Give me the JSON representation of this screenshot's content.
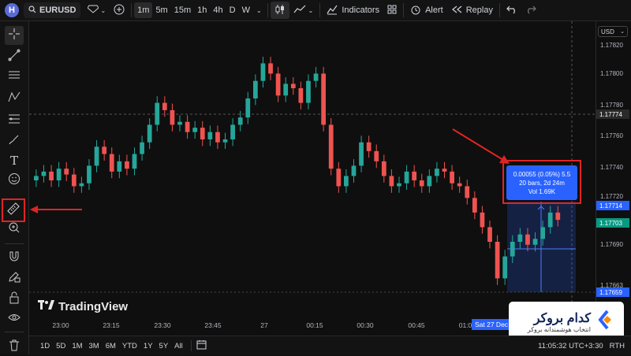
{
  "topbar": {
    "logo_letter": "H",
    "symbol": "EURUSD",
    "intervals": [
      "1m",
      "5m",
      "15m",
      "1h",
      "4h",
      "D",
      "W"
    ],
    "active_interval": "1m",
    "indicators_label": "Indicators",
    "alert_label": "Alert",
    "replay_label": "Replay"
  },
  "price_axis": {
    "currency": "USD",
    "labels": [
      "1.17820",
      "1.17800",
      "1.17780",
      "1.17760",
      "1.17740",
      "1.17720",
      "1.17690",
      "1.17663"
    ],
    "tags": [
      {
        "text": "1.17774",
        "bg": "#2a2a2a",
        "color": "#ffffff"
      },
      {
        "text": "1.17714",
        "bg": "#2962ff",
        "color": "#ffffff"
      },
      {
        "text": "1.17703",
        "bg": "#089981",
        "color": "#ffffff"
      },
      {
        "text": "1.17659",
        "bg": "#2962ff",
        "color": "#ffffff"
      }
    ]
  },
  "time_axis": {
    "labels": [
      "23:00",
      "23:15",
      "23:30",
      "23:45",
      "27",
      "00:15",
      "00:30",
      "00:45",
      "01:0"
    ],
    "highlight": "Sat 27 Dec"
  },
  "measure": {
    "line1": "0.00055 (0.05%) 5.5",
    "line2": "20 bars, 2d 24m",
    "line3": "Vol 1.69K"
  },
  "watermark": "TradingView",
  "bottom": {
    "ranges": [
      "1D",
      "5D",
      "1M",
      "3M",
      "6M",
      "YTD",
      "1Y",
      "5Y",
      "All"
    ],
    "clock": "11:05:32 UTC+3:30",
    "session": "RTH"
  },
  "brand": {
    "title": "کدام بروکر",
    "subtitle": "انتخاب هوشمندانه بروکر"
  },
  "colors": {
    "up": "#26a69a",
    "down": "#ef5350",
    "accent": "#2962ff",
    "annotation": "#e02424"
  },
  "chart_data": {
    "type": "candlestick",
    "symbol": "EURUSD",
    "interval": "1m",
    "y_range": [
      1.17655,
      1.1783
    ],
    "closes": [
      1.17735,
      1.17738,
      1.17732,
      1.1774,
      1.17736,
      1.17728,
      1.1773,
      1.17742,
      1.17755,
      1.1775,
      1.17738,
      1.17745,
      1.1774,
      1.1775,
      1.17758,
      1.1777,
      1.17785,
      1.1778,
      1.1777,
      1.17772,
      1.17765,
      1.17768,
      1.1776,
      1.17765,
      1.17758,
      1.1776,
      1.1777,
      1.17775,
      1.17788,
      1.178,
      1.17812,
      1.17805,
      1.1779,
      1.17798,
      1.17795,
      1.17785,
      1.178,
      1.17805,
      1.1777,
      1.1774,
      1.17728,
      1.17735,
      1.17742,
      1.17758,
      1.17752,
      1.17745,
      1.17735,
      1.17728,
      1.1773,
      1.17738,
      1.17732,
      1.17728,
      1.17735,
      1.1774,
      1.17738,
      1.1773,
      1.17728,
      1.1772,
      1.1771,
      1.177,
      1.1769,
      1.17665,
      1.1768,
      1.1769,
      1.17695,
      1.17688,
      1.17692,
      1.177,
      1.1771,
      1.17705
    ]
  }
}
